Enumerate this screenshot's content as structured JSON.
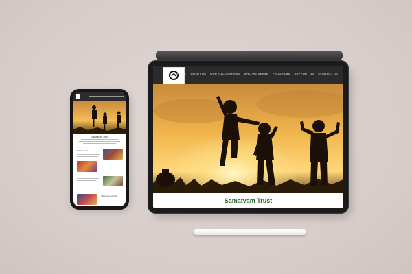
{
  "tablet": {
    "nav": {
      "items": [
        {
          "label": "HOME"
        },
        {
          "label": "ABOUT US"
        },
        {
          "label": "OUR FOCUS AREAS"
        },
        {
          "label": "WHO WE SERVE"
        },
        {
          "label": "PROGRAMS"
        },
        {
          "label": "SUPPORT US"
        },
        {
          "label": "CONTACT US"
        }
      ]
    },
    "title": "Samatvam Trust"
  },
  "phone": {
    "heading": "Samatvam Trust",
    "section_label": "What we do",
    "footer_label": "Welcome our Kids"
  },
  "colors": {
    "brand_green": "#2c6a2b",
    "nav_bg": "#2b2b2b",
    "sunset_orange": "#e8a23a",
    "background": "#d9cfcc"
  }
}
